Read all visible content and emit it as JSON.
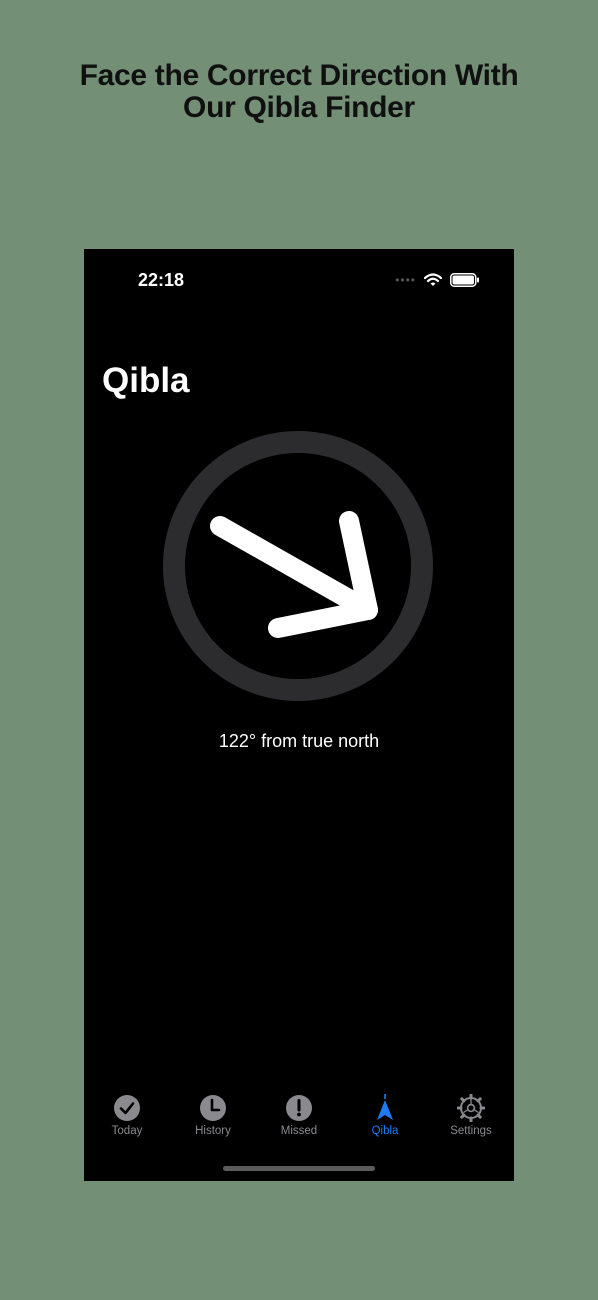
{
  "headline": {
    "line1": "Face the Correct Direction With",
    "line2": "Our Qibla Finder"
  },
  "status_bar": {
    "time": "22:18",
    "signal_icon": "signal-dots-icon",
    "wifi_icon": "wifi-icon",
    "battery_icon": "battery-icon"
  },
  "page": {
    "title": "Qibla"
  },
  "compass": {
    "bearing_degrees": 122,
    "bearing_text": "122° from true north",
    "arrow_icon": "direction-arrow-icon"
  },
  "tabs": [
    {
      "label": "Today",
      "icon": "checkmark-circle-icon",
      "active": false
    },
    {
      "label": "History",
      "icon": "clock-icon",
      "active": false
    },
    {
      "label": "Missed",
      "icon": "exclamation-circle-icon",
      "active": false
    },
    {
      "label": "Qibla",
      "icon": "compass-arrow-icon",
      "active": true
    },
    {
      "label": "Settings",
      "icon": "gear-icon",
      "active": false
    }
  ],
  "colors": {
    "background": "#738f76",
    "active_tab": "#1e7cf2",
    "inactive_tab": "#8a8a8e",
    "ring": "#2c2c2e"
  }
}
